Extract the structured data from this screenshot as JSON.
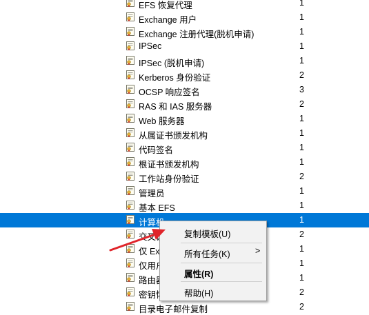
{
  "templates": [
    {
      "name": "EFS 恢复代理",
      "version": "1"
    },
    {
      "name": "Exchange 用户",
      "version": "1"
    },
    {
      "name": "Exchange 注册代理(脱机申请)",
      "version": "1"
    },
    {
      "name": "IPSec",
      "version": "1"
    },
    {
      "name": "IPSec (脱机申请)",
      "version": "1"
    },
    {
      "name": "Kerberos 身份验证",
      "version": "2"
    },
    {
      "name": "OCSP 响应签名",
      "version": "3"
    },
    {
      "name": "RAS 和 IAS 服务器",
      "version": "2"
    },
    {
      "name": "Web 服务器",
      "version": "1"
    },
    {
      "name": "从属证书颁发机构",
      "version": "1"
    },
    {
      "name": "代码签名",
      "version": "1"
    },
    {
      "name": "根证书颁发机构",
      "version": "1"
    },
    {
      "name": "工作站身份验证",
      "version": "2"
    },
    {
      "name": "管理员",
      "version": "1"
    },
    {
      "name": "基本 EFS",
      "version": "1"
    },
    {
      "name": "计算机",
      "version": "1",
      "selected": true
    },
    {
      "name": "交叉证",
      "version": "2"
    },
    {
      "name": "仅 Exc",
      "version": "1"
    },
    {
      "name": "仅用户",
      "version": "1"
    },
    {
      "name": "路由器",
      "version": "1"
    },
    {
      "name": "密钥恢",
      "version": "2"
    },
    {
      "name": "目录电子邮件复制",
      "version": "2"
    }
  ],
  "context_menu": {
    "duplicate": "复制模板(U)",
    "all_tasks": "所有任务(K)",
    "properties": "属性(R)",
    "help": "帮助(H)",
    "submenu_arrow": ">"
  },
  "colors": {
    "selection": "#0078d7",
    "annotation_arrow": "#e0242a"
  }
}
